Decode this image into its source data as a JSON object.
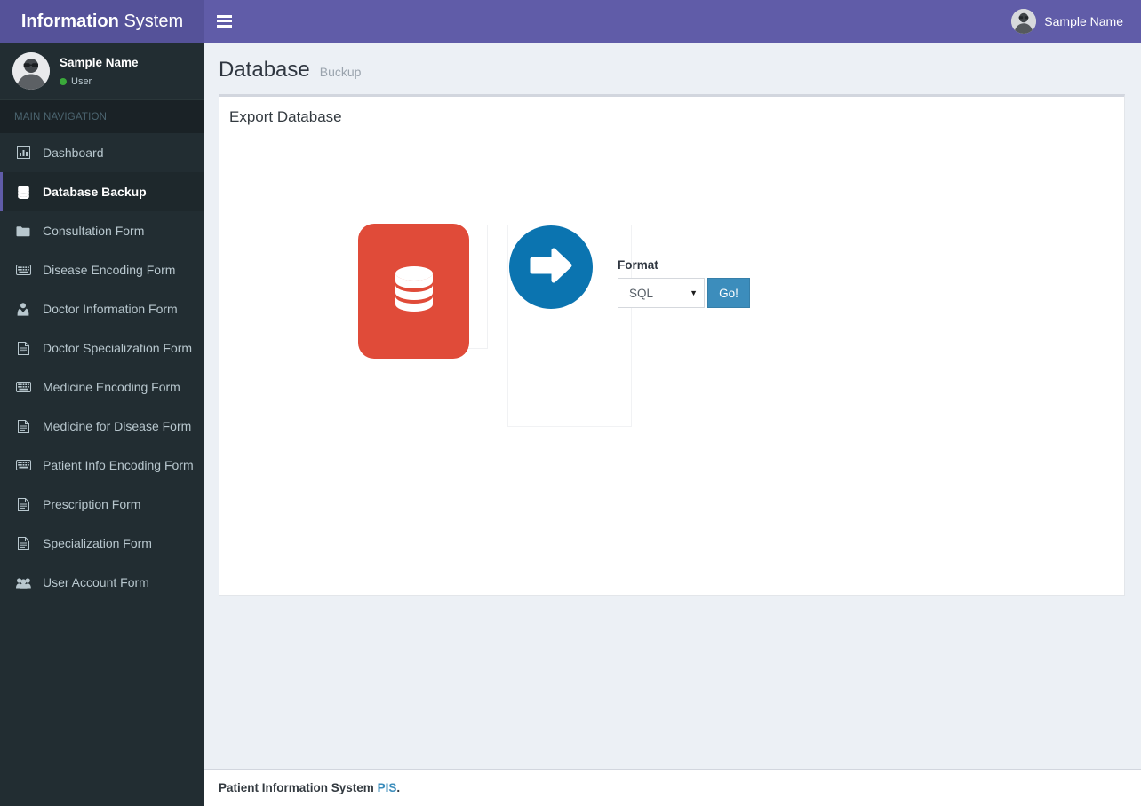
{
  "app": {
    "logo_bold": "Information",
    "logo_normal": "System",
    "header_user": "Sample Name",
    "menu_toggle_icon": "hamburger-icon",
    "header_color": "#605ca8",
    "logo_color": "#555299"
  },
  "sidebar": {
    "user_panel": {
      "name": "Sample Name",
      "status": "User",
      "status_color": "#3aa93a",
      "avatar_icon": "user-avatar"
    },
    "nav_header": "MAIN NAVIGATION",
    "items": [
      {
        "label": "Dashboard",
        "icon": "bar-chart-icon",
        "active": false
      },
      {
        "label": "Database Backup",
        "icon": "database-icon",
        "active": true
      },
      {
        "label": "Consultation Form",
        "icon": "folder-icon",
        "active": false
      },
      {
        "label": "Disease Encoding Form",
        "icon": "keyboard-icon",
        "active": false
      },
      {
        "label": "Doctor Information Form",
        "icon": "user-md-icon",
        "active": false
      },
      {
        "label": "Doctor Specialization Form",
        "icon": "file-text-icon",
        "active": false
      },
      {
        "label": "Medicine Encoding Form",
        "icon": "keyboard-icon",
        "active": false
      },
      {
        "label": "Medicine for Disease Form",
        "icon": "file-text-icon",
        "active": false
      },
      {
        "label": "Patient Info Encoding Form",
        "icon": "keyboard-icon",
        "active": false
      },
      {
        "label": "Prescription Form",
        "icon": "file-text-icon",
        "active": false
      },
      {
        "label": "Specialization Form",
        "icon": "file-text-icon",
        "active": false
      },
      {
        "label": "User Account Form",
        "icon": "users-icon",
        "active": false
      }
    ],
    "active_border_color": "#605ca8",
    "background": "#222d32"
  },
  "page": {
    "title": "Database",
    "subtitle": "Buckup"
  },
  "panel": {
    "title": "Export Database",
    "database_tile": {
      "icon": "database-icon",
      "color": "#e04b39"
    },
    "arrow": {
      "icon": "arrow-right-icon",
      "color": "#0b74b0"
    },
    "format": {
      "label": "Format",
      "selected": "SQL",
      "options": [
        "SQL"
      ],
      "caret_icon": "chevron-down-icon"
    },
    "go_button": {
      "label": "Go!",
      "color": "#3c8dbc"
    }
  },
  "footer": {
    "text": "Patient Information System",
    "link": "PIS",
    "suffix": "."
  }
}
